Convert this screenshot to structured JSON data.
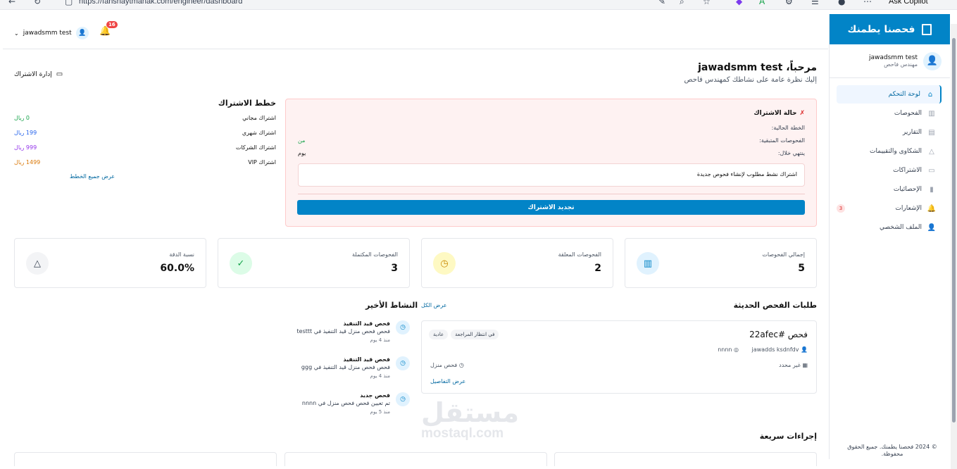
{
  "browser": {
    "url": "https://fahshaytmanak.com/engineer/dashboard",
    "copilot_label": "Ask Copilot"
  },
  "sidebar": {
    "brand": "فحصنا يطمنك",
    "user_name": "jawadsmm test",
    "user_role": "مهندس فاحص",
    "items": [
      {
        "label": "لوحة التحكم",
        "icon": "home-icon",
        "active": true
      },
      {
        "label": "الفحوصات",
        "icon": "building-icon"
      },
      {
        "label": "التقارير",
        "icon": "file-icon"
      },
      {
        "label": "الشكاوى والتقييمات",
        "icon": "warning-icon"
      },
      {
        "label": "الاشتراكات",
        "icon": "card-icon"
      },
      {
        "label": "الإحصائيات",
        "icon": "chart-icon"
      },
      {
        "label": "الإشعارات",
        "icon": "bell-icon",
        "count": "3"
      },
      {
        "label": "الملف الشخصي",
        "icon": "user-icon"
      }
    ],
    "copyright": "© 2024 فحصنا يطمنك. جميع الحقوق محفوظة."
  },
  "topbar": {
    "user_name": "jawadsmm test",
    "notifications_count": "16"
  },
  "welcome": {
    "title": "مرحباً، jawadsmm test",
    "subtitle": "إليك نظرة عامة على نشاطك كمهندس فاحص"
  },
  "manage_subscription": "إدارة الاشتراك",
  "subscription_status": {
    "title": "حالة الاشتراك",
    "current_plan_label": "الخطة الحالية:",
    "remaining_label": "الفحوصات المتبقية:",
    "remaining_value": "من",
    "expires_label": "ينتهي خلال:",
    "expires_value": "يوم",
    "note": "اشتراك نشط مطلوب لإنشاء فحوص جديدة",
    "renew_button": "تجديد الاشتراك"
  },
  "plans": {
    "title": "خطط الاشتراك",
    "items": [
      {
        "name": "اشتراك مجاني",
        "price": "0 ريال",
        "color": "#16a34a"
      },
      {
        "name": "اشتراك شهري",
        "price": "199 ريال",
        "color": "#2563eb"
      },
      {
        "name": "اشتراك الشركات",
        "price": "999 ريال",
        "color": "#9333ea"
      },
      {
        "name": "اشتراك VIP",
        "price": "1499 ريال",
        "color": "#d97706"
      }
    ],
    "view_all": "عرض جميع الخطط"
  },
  "stats": [
    {
      "label": "إجمالي الفحوصات",
      "value": "5",
      "icon": "building-icon",
      "bg": "#e0f2fe",
      "fg": "#0284c7"
    },
    {
      "label": "الفحوصات المعلقة",
      "value": "2",
      "icon": "clock-icon",
      "bg": "#fef9c3",
      "fg": "#ca8a04"
    },
    {
      "label": "الفحوصات المكتملة",
      "value": "3",
      "icon": "check-circle-icon",
      "bg": "#dcfce7",
      "fg": "#16a34a"
    },
    {
      "label": "نسبة الدقة",
      "value": "60.0%",
      "icon": "warning-icon",
      "bg": "#f3f4f6",
      "fg": "#374151"
    }
  ],
  "requests": {
    "title": "طلبات الفحص الحديثة",
    "view_all": "عرض الكل",
    "item": {
      "title": "فحص #22afec",
      "tags": [
        "في انتظار المراجعة",
        "عادية"
      ],
      "client": "jawadds ksdnfdv",
      "location": "nnnn",
      "date": "غير محدد",
      "type": "فحص منزل",
      "details_link": "عرض التفاصيل"
    }
  },
  "activity": {
    "title": "النشاط الأخير",
    "items": [
      {
        "title": "فحص قيد التنفيذ",
        "desc": "فحص فحص منزل قيد التنفيذ في testtt",
        "time": "منذ 4 يوم"
      },
      {
        "title": "فحص قيد التنفيذ",
        "desc": "فحص فحص منزل قيد التنفيذ في ggg",
        "time": "منذ 4 يوم"
      },
      {
        "title": "فحص جديد",
        "desc": "تم تعيين فحص فحص منزل في nnnn",
        "time": "منذ 5 يوم"
      }
    ]
  },
  "quick_actions": {
    "title": "إجراءات سريعة"
  },
  "watermark": {
    "arabic": "مستقل",
    "latin": "mostaql.com"
  }
}
